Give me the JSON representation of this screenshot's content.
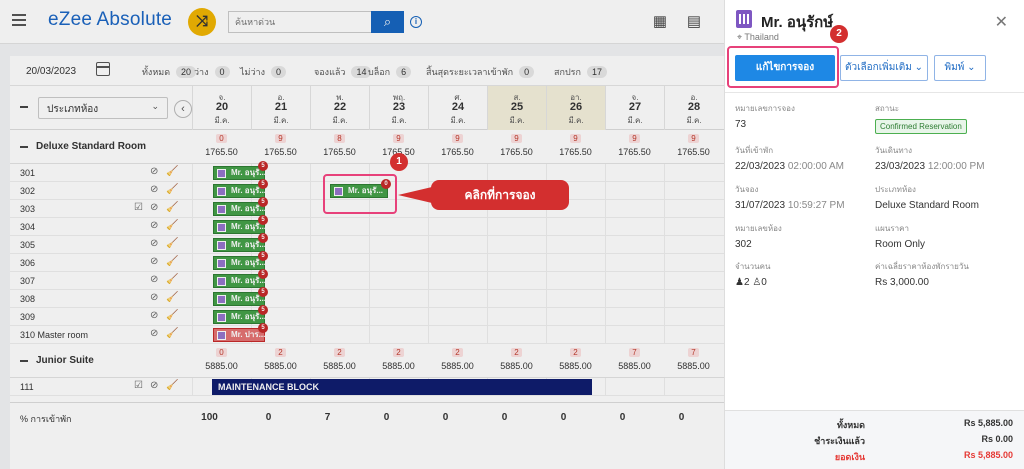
{
  "app": {
    "logo": "eZee Absolute",
    "search_placeholder": "ค้นหาด่วน"
  },
  "filterbar": {
    "date": "20/03/2023",
    "stats": [
      {
        "label": "ทั้งหมด",
        "count": "20"
      },
      {
        "label": "ว่าง",
        "count": "0"
      },
      {
        "label": "ไม่ว่าง",
        "count": "0"
      },
      {
        "label": "จองแล้ว",
        "count": "14"
      },
      {
        "label": "บล็อก",
        "count": "6"
      },
      {
        "label": "สิ้นสุดระยะเวลาเข้าพัก",
        "count": "0"
      },
      {
        "label": "สกปรก",
        "count": "17"
      }
    ]
  },
  "grid": {
    "room_type_select": "ประเภทห้อง",
    "days": [
      {
        "dow": "จ.",
        "day": "20",
        "month": "มี.ค.",
        "weekend": false
      },
      {
        "dow": "อ.",
        "day": "21",
        "month": "มี.ค.",
        "weekend": false
      },
      {
        "dow": "พ.",
        "day": "22",
        "month": "มี.ค.",
        "weekend": false
      },
      {
        "dow": "พฤ.",
        "day": "23",
        "month": "มี.ค.",
        "weekend": false
      },
      {
        "dow": "ศ.",
        "day": "24",
        "month": "มี.ค.",
        "weekend": false
      },
      {
        "dow": "ส.",
        "day": "25",
        "month": "มี.ค.",
        "weekend": true
      },
      {
        "dow": "อา.",
        "day": "26",
        "month": "มี.ค.",
        "weekend": true
      },
      {
        "dow": "จ.",
        "day": "27",
        "month": "มี.ค.",
        "weekend": false
      },
      {
        "dow": "อ.",
        "day": "28",
        "month": "มี.ค.",
        "weekend": false
      }
    ],
    "categories": [
      {
        "name": "Deluxe Standard Room",
        "avail": [
          "0",
          "9",
          "8",
          "9",
          "9",
          "9",
          "9",
          "9",
          "9"
        ],
        "price": [
          "1765.50",
          "1765.50",
          "1765.50",
          "1765.50",
          "1765.50",
          "1765.50",
          "1765.50",
          "1765.50",
          "1765.50"
        ]
      },
      {
        "name": "Junior Suite",
        "avail": [
          "0",
          "2",
          "2",
          "2",
          "2",
          "2",
          "2",
          "7",
          "7"
        ],
        "price": [
          "5885.00",
          "5885.00",
          "5885.00",
          "5885.00",
          "5885.00",
          "5885.00",
          "5885.00",
          "5885.00",
          "5885.00"
        ]
      }
    ],
    "rooms": [
      "301",
      "302",
      "303",
      "304",
      "305",
      "306",
      "307",
      "308",
      "309",
      "310 Master room"
    ],
    "suite_rooms": [
      "111"
    ],
    "bookings": [
      {
        "label": "Mr. อนุรั...",
        "badge": "5"
      },
      {
        "label": "Mr. อนุรั...",
        "badge": "5"
      },
      {
        "label": "Mr. อนุรั...",
        "badge": "5"
      },
      {
        "label": "Mr. อนุรั...",
        "badge": "5"
      },
      {
        "label": "Mr. อนุรั...",
        "badge": "5"
      },
      {
        "label": "Mr. อนุรั...",
        "badge": "5"
      },
      {
        "label": "Mr. อนุรั...",
        "badge": "5"
      },
      {
        "label": "Mr. อนุรั...",
        "badge": "5"
      },
      {
        "label": "Mr. อนุรั...",
        "badge": "5"
      },
      {
        "label": "Mr. ปาร...",
        "badge": "5"
      }
    ],
    "selected_booking": {
      "label": "Mr. อนุรั...",
      "badge": "0"
    },
    "maintenance": "MAINTENANCE BLOCK",
    "occupancy_label": "% การเข้าพัก",
    "occupancy": [
      "100",
      "0",
      "7",
      "0",
      "0",
      "0",
      "0",
      "0",
      "0"
    ]
  },
  "annotations": {
    "step1": "1",
    "step2": "2",
    "callout": "คลิกที่การจอง"
  },
  "panel": {
    "guest_name": "Mr. อนุรักษ์",
    "country": "Thailand",
    "edit_button": "แก้ไขการจอง",
    "more_options": "ตัวเลือกเพิ่มเติม",
    "print": "พิมพ์",
    "fields": {
      "res_no_label": "หมายเลขการจอง",
      "res_no": "73",
      "status_label": "สถานะ",
      "status": "Confirmed Reservation",
      "checkin_label": "วันที่เข้าพัก",
      "checkin_date": "22/03/2023",
      "checkin_time": "02:00:00 AM",
      "checkout_label": "วันเดินทาง",
      "checkout_date": "23/03/2023",
      "checkout_time": "12:00:00 PM",
      "booked_label": "วันจอง",
      "booked_date": "31/07/2023",
      "booked_time": "10:59:27 PM",
      "roomtype_label": "ประเภทห้อง",
      "roomtype": "Deluxe Standard Room",
      "roomno_label": "หมายเลขห้อง",
      "roomno": "302",
      "rateplan_label": "แผนราคา",
      "rateplan": "Room Only",
      "pax_label": "จำนวนคน",
      "adults": "2",
      "children": "0",
      "avgrate_label": "ค่าเฉลี่ยราคาห้องพักรายวัน",
      "avgrate": "Rs 3,000.00"
    },
    "footer": {
      "total_label": "ทั้งหมด",
      "total": "Rs 5,885.00",
      "paid_label": "ชำระเงินแล้ว",
      "paid": "Rs 0.00",
      "balance_label": "ยอดเงิน",
      "balance": "Rs 5,885.00"
    }
  }
}
